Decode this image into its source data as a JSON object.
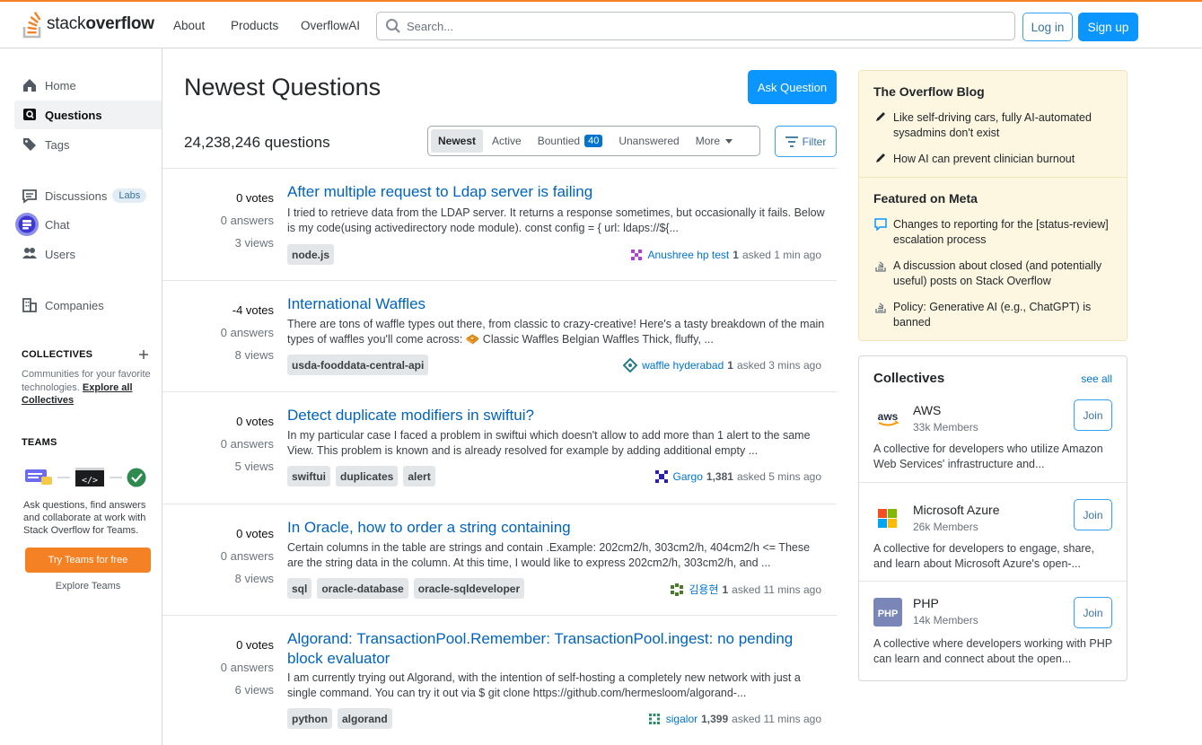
{
  "header": {
    "logo_light": "stack",
    "logo_bold": "overflow",
    "nav": [
      "About",
      "Products",
      "OverflowAI"
    ],
    "search_placeholder": "Search...",
    "login": "Log in",
    "signup": "Sign up"
  },
  "sidebar": {
    "items": [
      {
        "label": "Home",
        "icon": "home-icon"
      },
      {
        "label": "Questions",
        "icon": "questions-icon",
        "active": true
      },
      {
        "label": "Tags",
        "icon": "tag-icon"
      },
      {
        "label": "Discussions",
        "icon": "discussions-icon",
        "badge": "Labs"
      },
      {
        "label": "Chat",
        "icon": "chat-icon"
      },
      {
        "label": "Users",
        "icon": "users-icon"
      },
      {
        "label": "Companies",
        "icon": "companies-icon"
      }
    ],
    "collectives_title": "COLLECTIVES",
    "collectives_desc": "Communities for your favorite technologies.",
    "collectives_link": "Explore all Collectives",
    "teams_title": "TEAMS",
    "teams_desc": "Ask questions, find answers and collaborate at work with Stack Overflow for Teams.",
    "teams_button": "Try Teams for free",
    "explore_teams": "Explore Teams"
  },
  "main": {
    "title": "Newest Questions",
    "ask_button": "Ask Question",
    "count": "24,238,246 questions",
    "tabs": [
      {
        "label": "Newest",
        "active": true
      },
      {
        "label": "Active"
      },
      {
        "label": "Bountied",
        "badge": "40"
      },
      {
        "label": "Unanswered"
      },
      {
        "label": "More"
      }
    ],
    "filter_button": "Filter",
    "questions": [
      {
        "votes": "0 votes",
        "answers": "0 answers",
        "views": "3 views",
        "title": "After multiple request to Ldap server is failing",
        "excerpt": "I tried to retrieve data from the LDAP server. It returns a response sometimes, but occasionally it fails. Below is my code(using activedirectory node module). const config = { url: ldaps://${...",
        "tags": [
          "node.js"
        ],
        "user": "Anushree hp test",
        "rep": "1",
        "time": "asked 1 min ago",
        "avatar_color": "#b33fd6"
      },
      {
        "votes": "-4 votes",
        "answers": "0 answers",
        "views": "8 views",
        "title": "International Waffles",
        "excerpt": "There are tons of waffle types out there, from classic to crazy-creative! Here's a tasty breakdown of the main types of waffles you'll come across: 🧇 Classic Waffles Belgian Waffles Thick, fluffy, ...",
        "tags": [
          "usda-fooddata-central-api"
        ],
        "user": "waffle hyderabad",
        "rep": "1",
        "time": "asked 3 mins ago",
        "avatar_color": "#2a7a8c"
      },
      {
        "votes": "0 votes",
        "answers": "0 answers",
        "views": "5 views",
        "title": "Detect duplicate modifiers in swiftui?",
        "excerpt": "In my particular case I faced a problem in swiftui which doesn't allow to add more than 1 alert to the same View. This problem is known and is already resolved for example by adding additional empty ...",
        "tags": [
          "swiftui",
          "duplicates",
          "alert"
        ],
        "user": "Gargo",
        "rep": "1,381",
        "time": "asked 5 mins ago",
        "avatar_color": "#2b1fb0"
      },
      {
        "votes": "0 votes",
        "answers": "0 answers",
        "views": "8 views",
        "title": "In Oracle, how to order a string containing",
        "excerpt": "Certain columns in the table are strings and contain .Example: 202cm2/h, 303cm2/h, 404cm2/h <= These are the string data in the column. At this time, I would like to express 202cm2/h, 303cm2/h, and ...",
        "tags": [
          "sql",
          "oracle-database",
          "oracle-sqldeveloper"
        ],
        "user": "김용현",
        "rep": "1",
        "time": "asked 11 mins ago",
        "avatar_color": "#4c7a2a"
      },
      {
        "votes": "0 votes",
        "answers": "0 answers",
        "views": "6 views",
        "title": "Algorand: TransactionPool.Remember: TransactionPool.ingest: no pending block evaluator",
        "excerpt": "I am currently trying out Algorand, with the intention of self-hosting a completely new network with just a single command. You can try it out via $ git clone https://github.com/hermesloom/algorand-...",
        "tags": [
          "python",
          "algorand"
        ],
        "user": "sigalor",
        "rep": "1,399",
        "time": "asked 11 mins ago",
        "avatar_color": "#2a8c6a"
      }
    ]
  },
  "blog": {
    "title": "The Overflow Blog",
    "items": [
      "Like self-driving cars, fully AI-automated sysadmins don't exist",
      "How AI can prevent clinician burnout"
    ],
    "meta_title": "Featured on Meta",
    "meta_items": [
      "Changes to reporting for the [status-review] escalation process",
      "A discussion about closed (and potentially useful) posts on Stack Overflow",
      "Policy: Generative AI (e.g., ChatGPT) is banned"
    ]
  },
  "collectives": {
    "title": "Collectives",
    "see_all": "see all",
    "join_label": "Join",
    "items": [
      {
        "name": "AWS",
        "members": "33k Members",
        "desc": "A collective for developers who utilize Amazon Web Services' infrastructure and..."
      },
      {
        "name": "Microsoft Azure",
        "members": "26k Members",
        "desc": "A collective for developers to engage, share, and learn about Microsoft Azure's open-..."
      },
      {
        "name": "PHP",
        "members": "14k Members",
        "desc": "A collective where developers working with PHP can learn and connect about the open..."
      }
    ]
  },
  "colors": {
    "brand_orange": "#f48225",
    "primary_blue": "#0a95ff",
    "link_blue": "#0063bf"
  }
}
